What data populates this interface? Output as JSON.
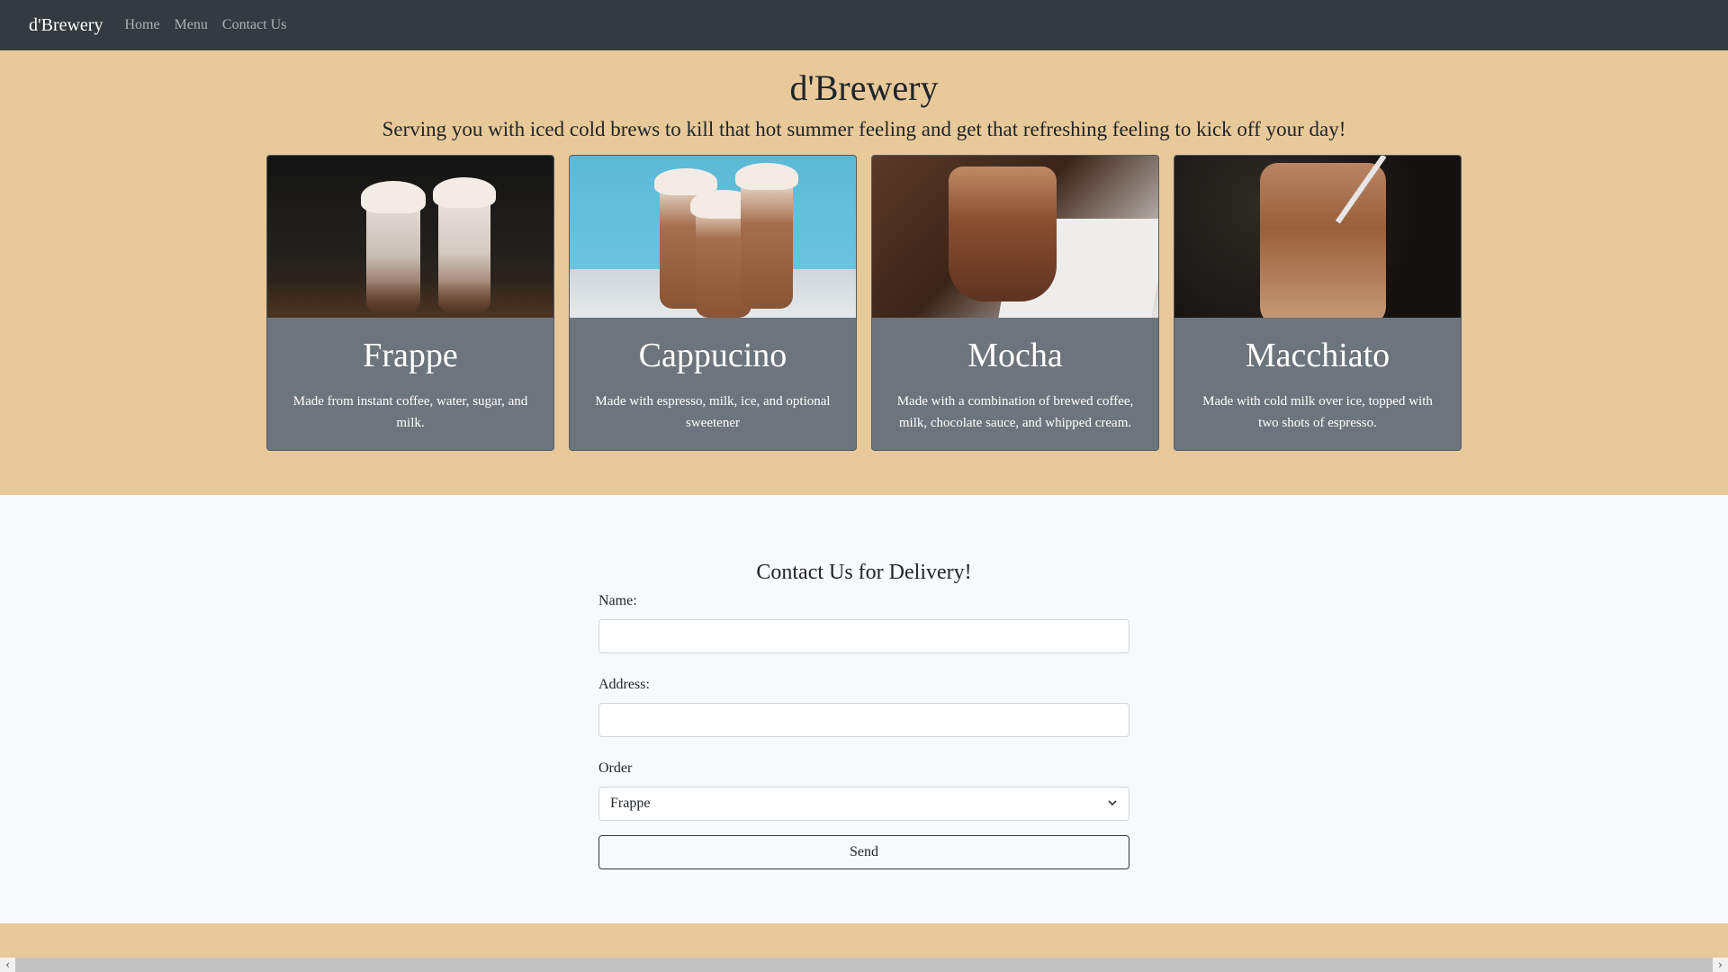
{
  "navbar": {
    "brand": "d'Brewery",
    "links": [
      "Home",
      "Menu",
      "Contact Us"
    ]
  },
  "hero": {
    "title": "d'Brewery",
    "subtitle": "Serving you with iced cold brews to kill that hot summer feeling and get that refreshing feeling to kick off your day!"
  },
  "cards": [
    {
      "title": "Frappe",
      "text": "Made from instant coffee, water, sugar, and milk.",
      "image": "frappe-image"
    },
    {
      "title": "Cappucino",
      "text": "Made with espresso, milk, ice, and optional sweetener",
      "image": "cappucino-image"
    },
    {
      "title": "Mocha",
      "text": "Made with a combination of brewed coffee, milk, chocolate sauce, and whipped cream.",
      "image": "mocha-image"
    },
    {
      "title": "Macchiato",
      "text": "Made with cold milk over ice, topped with two shots of espresso.",
      "image": "macchiato-image"
    }
  ],
  "contact": {
    "title": "Contact Us for Delivery!",
    "name_label": "Name:",
    "name_value": "",
    "address_label": "Address:",
    "address_value": "",
    "order_label": "Order",
    "order_selected": "Frappe",
    "send_label": "Send"
  },
  "colors": {
    "navbar": "#343a40",
    "hero_bg": "#e8c99a",
    "card_bg": "#6c757d",
    "page_bg": "#f8f9fa"
  }
}
